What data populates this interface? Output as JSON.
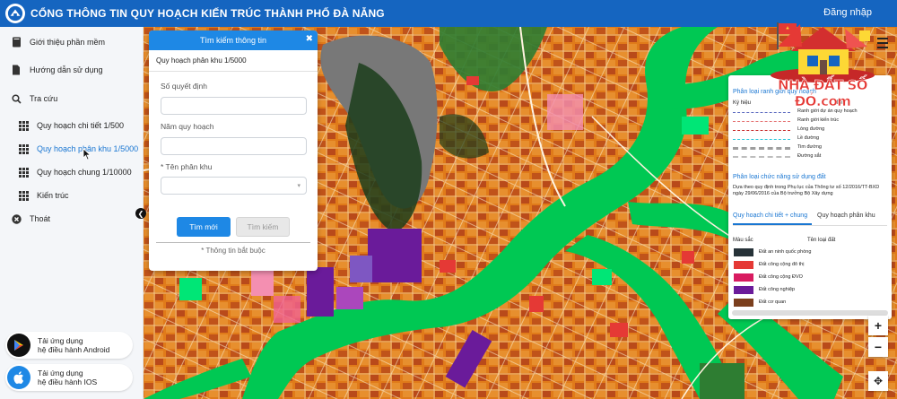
{
  "header": {
    "title": "CỔNG THÔNG TIN QUY HOẠCH KIẾN TRÚC THÀNH PHỐ ĐÀ NẴNG",
    "login": "Đăng nhập",
    "color": "#1565c0"
  },
  "sidebar": {
    "items": [
      {
        "label": "Giới thiệu phần mềm",
        "icon": "book-icon"
      },
      {
        "label": "Hướng dẫn sử dụng",
        "icon": "document-icon"
      },
      {
        "label": "Tra cứu",
        "icon": "search-icon"
      },
      {
        "label": "Quy hoạch chi tiết 1/500",
        "icon": "grid-icon"
      },
      {
        "label": "Quy hoạch phân khu 1/5000",
        "icon": "grid-icon"
      },
      {
        "label": "Quy hoạch chung 1/10000",
        "icon": "grid-icon"
      },
      {
        "label": "Kiến trúc",
        "icon": "grid-icon"
      },
      {
        "label": "Thoát",
        "icon": "close-circle-icon"
      }
    ],
    "active_index": 4,
    "android": {
      "line1": "Tải ứng dụng",
      "line2": "hệ điều hành Android"
    },
    "ios": {
      "line1": "Tải ứng dụng",
      "line2": "hệ điều hành IOS"
    }
  },
  "search_panel": {
    "title": "Tìm kiếm thông tin",
    "subtitle": "Quy hoạch phân khu 1/5000",
    "field1_label": "Số quyết định",
    "field2_label": "Năm quy hoạch",
    "field3_label": "* Tên phân khu",
    "btn_new": "Tìm mới",
    "btn_search": "Tìm kiếm",
    "note": "* Thông tin bắt buộc"
  },
  "legend": {
    "section1_title": "Phân loại ranh giới quy hoạch",
    "col_symbol": "Ký hiệu",
    "col_name": "Tên",
    "lines": [
      {
        "name": "Ranh giới dự án quy hoạch",
        "color": "#5c6bc0",
        "style": "dashed"
      },
      {
        "name": "Ranh giới kiến trúc",
        "color": "#e57373",
        "style": "dashed"
      },
      {
        "name": "Lòng đường",
        "color": "#c62828",
        "style": "dashed"
      },
      {
        "name": "Lề đường",
        "color": "#26c6da",
        "style": "dashed"
      },
      {
        "name": "Tim đường",
        "color": "#9e9e9e",
        "style": "dashdot"
      },
      {
        "name": "Đường sắt",
        "color": "#bdbdbd",
        "style": "dashed"
      }
    ],
    "section2_title": "Phân loại chức năng sử dụng đất",
    "section2_desc": "Dựa theo quy định trong Phụ lục của Thông tư số 12/2016/TT-BXD ngày 29/06/2016 của Bộ trưởng Bộ Xây dựng",
    "tab1": "Quy hoạch chi tiết + chung",
    "tab2": "Quy hoạch phân khu",
    "col_color": "Màu sắc",
    "col_land": "Tên loại đất",
    "swatches": [
      {
        "name": "Đất an ninh quốc phòng",
        "color": "#263238"
      },
      {
        "name": "Đất công cộng đô thị",
        "color": "#e53935"
      },
      {
        "name": "Đất công cộng ĐVO",
        "color": "#d81b60"
      },
      {
        "name": "Đất công nghiệp",
        "color": "#6a1b9a"
      },
      {
        "name": "Đất cơ quan",
        "color": "#7b3f1d"
      }
    ]
  },
  "watermark": {
    "text": "NHÀ ĐẤT SỐ ĐỎ.com"
  },
  "map_controls": {
    "zoom_in": "+",
    "zoom_out": "−",
    "move": "✥"
  },
  "colors": {
    "river": "#00c853",
    "residential": "#e07b1a",
    "industrial": "#6a1b9a",
    "lake": "#787878",
    "forest": "#1b3d1b"
  }
}
